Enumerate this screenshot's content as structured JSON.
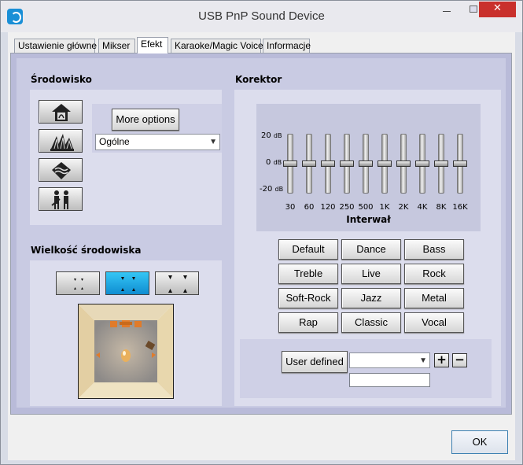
{
  "window": {
    "title": "USB PnP Sound Device",
    "close_label": "✕"
  },
  "tabs": [
    {
      "label": "Ustawienie główne"
    },
    {
      "label": "Mikser"
    },
    {
      "label": "Efekt"
    },
    {
      "label": "Karaoke/Magic Voice"
    },
    {
      "label": "Informacje"
    }
  ],
  "environment": {
    "title": "Środowisko",
    "more_options_label": "More options",
    "selected": "Ogólne",
    "icons": [
      "house-icon",
      "opera-house-icon",
      "underwater-icon",
      "concert-people-icon"
    ]
  },
  "room_size": {
    "title": "Wielkość środowiska",
    "selected_index": 1
  },
  "equalizer": {
    "title": "Korektor",
    "db_labels": [
      {
        "value": "20",
        "unit": "dB"
      },
      {
        "value": "0",
        "unit": "dB"
      },
      {
        "value": "-20",
        "unit": "dB"
      }
    ],
    "bands": [
      "30",
      "60",
      "120",
      "250",
      "500",
      "1K",
      "2K",
      "4K",
      "8K",
      "16K"
    ],
    "band_gains_db": [
      0,
      0,
      0,
      0,
      0,
      0,
      0,
      0,
      0,
      0
    ],
    "interval_label": "Interwał",
    "presets": [
      "Default",
      "Dance",
      "Bass",
      "Treble",
      "Live",
      "Rock",
      "Soft-Rock",
      "Jazz",
      "Metal",
      "Rap",
      "Classic",
      "Vocal"
    ],
    "user_defined_label": "User defined",
    "user_defined_selected": "",
    "plus_label": "+",
    "minus_label": "−",
    "name_value": ""
  },
  "footer": {
    "ok_label": "OK"
  },
  "colors": {
    "panel": "#c9cbe3",
    "active_accent": "#1a9fe0",
    "close": "#c9302c"
  }
}
